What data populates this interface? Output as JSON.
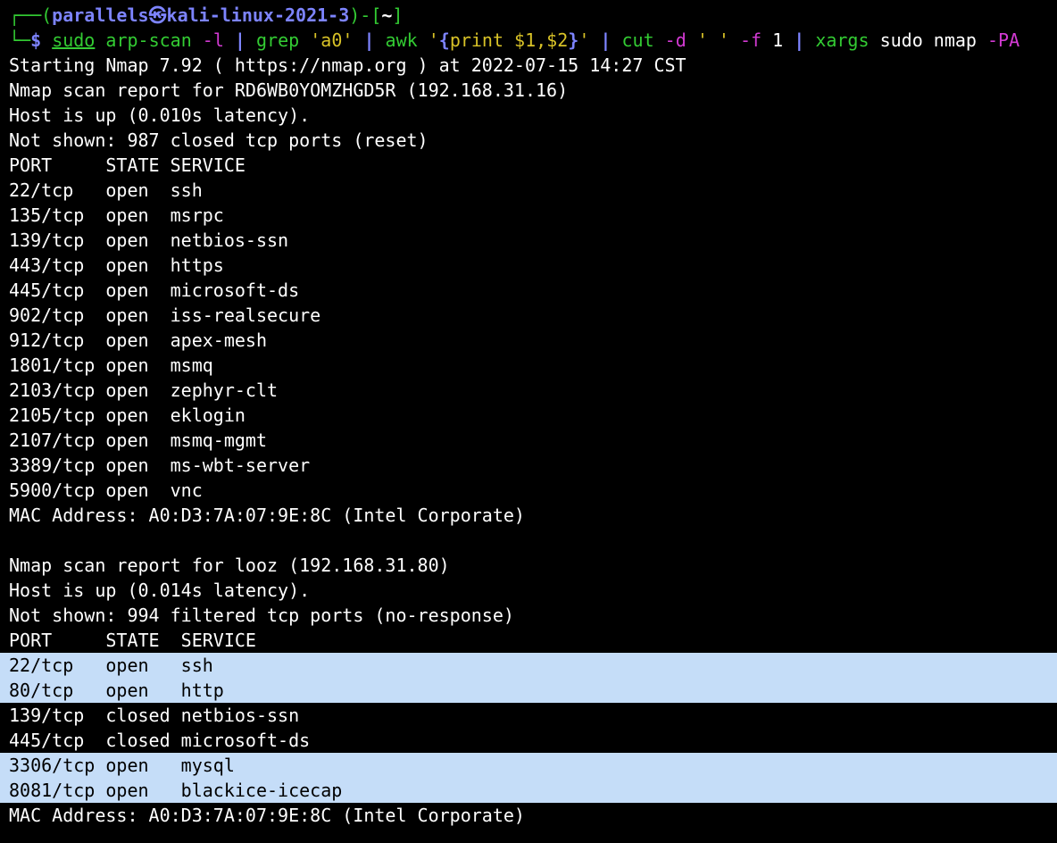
{
  "prompt": {
    "corner_top": "┌──(",
    "user_host": "parallels㉿kali-linux-2021-3",
    "sep": ")-[",
    "cwd": "~",
    "close": "]",
    "corner_bottom": "└─",
    "dollar": "$"
  },
  "command": {
    "sudo": "sudo",
    "arp_scan": "arp-scan",
    "arp_flag": "-l",
    "pipe": "|",
    "grep": "grep",
    "grep_arg": "'a0'",
    "awk": "awk",
    "awk_q1": "'",
    "awk_open": "{",
    "awk_body": "print $1,$2",
    "awk_close": "}",
    "awk_q2": "'",
    "cut": "cut",
    "cut_d": "-d",
    "cut_delim": "' '",
    "cut_f": "-f",
    "cut_num": "1",
    "xargs": "xargs",
    "tail_cmd": "sudo nmap",
    "nmap_flag": "-PA"
  },
  "output": {
    "starting": "Starting Nmap 7.92 ( https://nmap.org ) at 2022-07-15 14:27 CST",
    "host1": {
      "report": "Nmap scan report for RD6WB0YOMZHGD5R (192.168.31.16)",
      "status": "Host is up (0.010s latency).",
      "not_shown": "Not shown: 987 closed tcp ports (reset)",
      "header": "PORT     STATE SERVICE",
      "ports": [
        "22/tcp   open  ssh",
        "135/tcp  open  msrpc",
        "139/tcp  open  netbios-ssn",
        "443/tcp  open  https",
        "445/tcp  open  microsoft-ds",
        "902/tcp  open  iss-realsecure",
        "912/tcp  open  apex-mesh",
        "1801/tcp open  msmq",
        "2103/tcp open  zephyr-clt",
        "2105/tcp open  eklogin",
        "2107/tcp open  msmq-mgmt",
        "3389/tcp open  ms-wbt-server",
        "5900/tcp open  vnc"
      ],
      "mac": "MAC Address: A0:D3:7A:07:9E:8C (Intel Corporate)"
    },
    "host2": {
      "report": "Nmap scan report for looz (192.168.31.80)",
      "status": "Host is up (0.014s latency).",
      "not_shown": "Not shown: 994 filtered tcp ports (no-response)",
      "header": "PORT     STATE  SERVICE",
      "ports": [
        "22/tcp   open   ssh",
        "80/tcp   open   http",
        "139/tcp  closed netbios-ssn",
        "445/tcp  closed microsoft-ds",
        "3306/tcp open   mysql",
        "8081/tcp open   blackice-icecap"
      ],
      "mac": "MAC Address: A0:D3:7A:07:9E:8C (Intel Corporate)"
    }
  },
  "colors": {
    "background": "#000000",
    "text": "#ffffff",
    "prompt_green": "#33cc33",
    "prompt_blue": "#7d84ff",
    "string_yellow": "#d8c227",
    "flag_magenta": "#d33ad3",
    "selection": "#c5ddf8"
  }
}
